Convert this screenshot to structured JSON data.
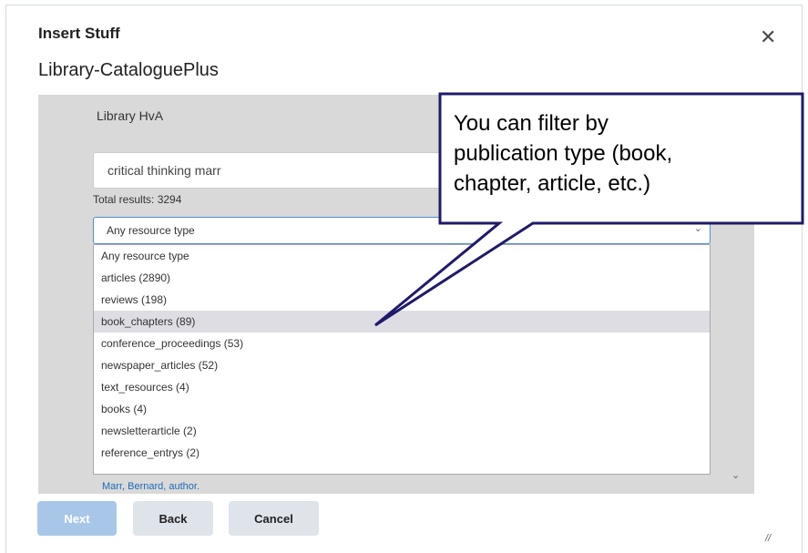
{
  "dialog": {
    "title": "Insert Stuff",
    "subtitle": "Library-CataloguePlus",
    "close_icon": "close-icon"
  },
  "library": {
    "name": "Library HvA",
    "search_value": "critical thinking marr",
    "total_results": "Total results: 3294",
    "resource_select": "Any resource type"
  },
  "dropdown": {
    "options": [
      "Any resource type",
      "articles (2890)",
      "reviews (198)",
      "book_chapters (89)",
      "conference_proceedings (53)",
      "newspaper_articles (52)",
      "text_resources (4)",
      "books (4)",
      "newsletterarticle (2)",
      "reference_entrys (2)"
    ],
    "highlighted": "book_chapters (89)"
  },
  "result_peek": "Marr, Bernard, author.",
  "buttons": {
    "next": "Next",
    "back": "Back",
    "cancel": "Cancel"
  },
  "callout": {
    "line1": "You can filter by",
    "line2": "publication type (book,",
    "line3": "chapter, article, etc.)"
  },
  "colors": {
    "accent": "#4e8fd1",
    "next_button": "#a8c7e8",
    "secondary_button": "#dfe3ea",
    "callout_border": "#1f1a6b",
    "highlight": "#dddde3",
    "link": "#1a6cb9"
  }
}
